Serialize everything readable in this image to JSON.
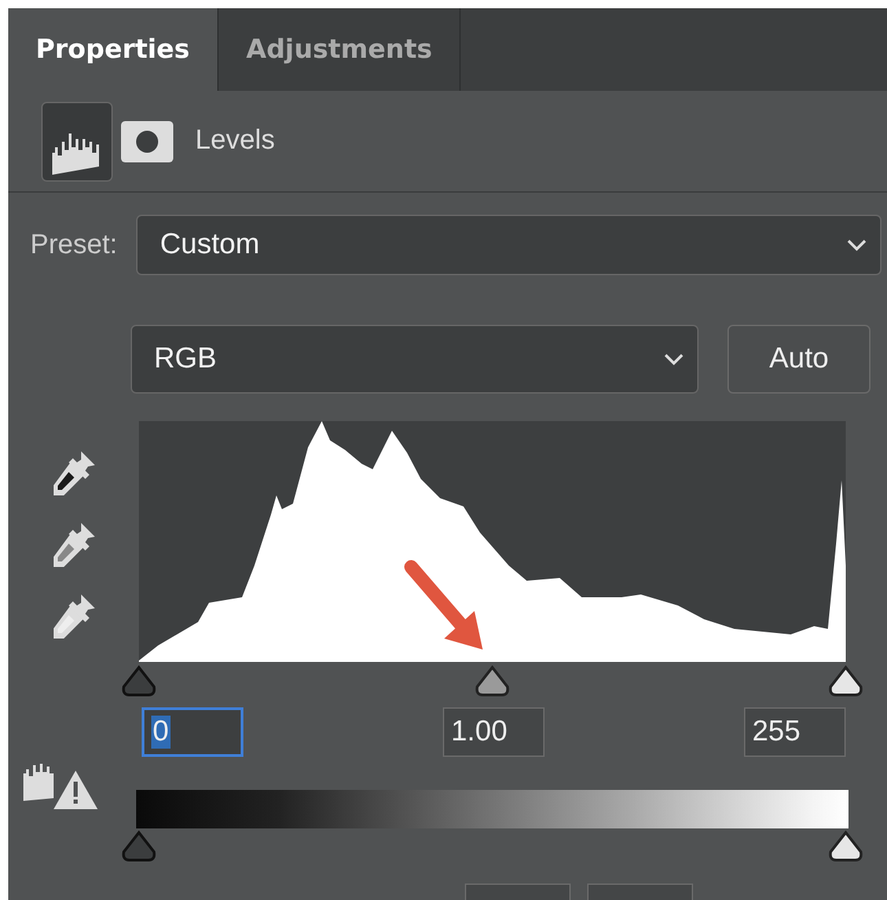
{
  "tabs": [
    {
      "label": "Properties",
      "selected": true
    },
    {
      "label": "Adjustments",
      "selected": false
    }
  ],
  "header": {
    "title": "Levels"
  },
  "preset": {
    "label": "Preset:",
    "value": "Custom"
  },
  "channel": {
    "value": "RGB"
  },
  "auto_button": "Auto",
  "input_sliders": [
    {
      "kind": "shadow",
      "level": 0
    },
    {
      "kind": "midtone",
      "level": 0.5
    },
    {
      "kind": "highlight",
      "level": 1
    }
  ],
  "input_fields": [
    {
      "value": "0",
      "focused": true
    },
    {
      "value": "1.00",
      "focused": false
    },
    {
      "value": "255",
      "focused": false
    }
  ],
  "output_sliders": [
    {
      "kind": "shadow",
      "level": 0
    },
    {
      "kind": "highlight",
      "level": 1
    }
  ]
}
